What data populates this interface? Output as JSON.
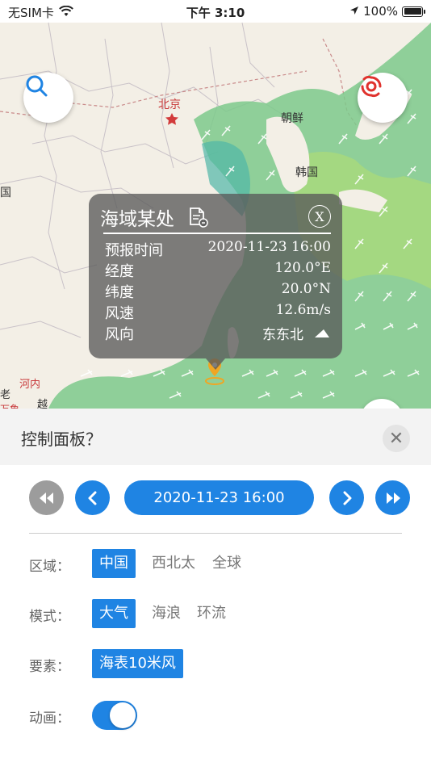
{
  "status_bar": {
    "carrier": "无SIM卡",
    "time": "下午 3:10",
    "battery": "100%"
  },
  "map": {
    "labels": {
      "beijing": "北京",
      "korea": "韩国",
      "north_korea": "朝鲜",
      "mongolia_fragment": "国",
      "henei": "河内",
      "ao": "老",
      "yue": "越",
      "wanxiang": "万象"
    },
    "colors": {
      "land": "#f3efe6",
      "sea_wind": "#7cc98b",
      "accent": "#1f84e3"
    }
  },
  "popup": {
    "title": "海域某处",
    "close_label": "X",
    "rows": [
      {
        "key": "预报时间",
        "value": "2020-11-23 16:00"
      },
      {
        "key": "经度",
        "value": "120.0°E"
      },
      {
        "key": "纬度",
        "value": "20.0°N"
      },
      {
        "key": "风速",
        "value": "12.6m/s"
      },
      {
        "key": "风向",
        "value": "东东北"
      }
    ]
  },
  "panel": {
    "title": "控制面板？",
    "time": "2020-11-23 16:00",
    "region": {
      "label": "区域：",
      "options": [
        "中国",
        "西北太",
        "全球"
      ],
      "selected": "中国"
    },
    "mode": {
      "label": "模式：",
      "options": [
        "大气",
        "海浪",
        "环流"
      ],
      "selected": "大气"
    },
    "element": {
      "label": "要素：",
      "options": [
        "海表10米风"
      ],
      "selected": "海表10米风"
    },
    "animation": {
      "label": "动画：",
      "enabled": true
    }
  }
}
